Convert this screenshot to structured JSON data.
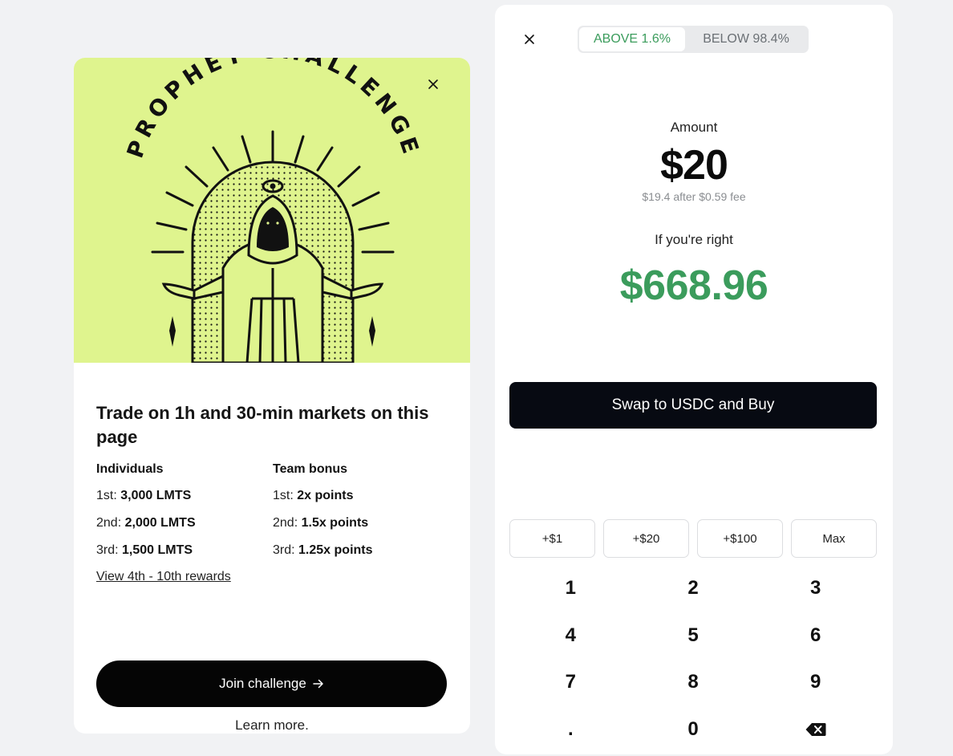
{
  "promo": {
    "hero_text": "PROPHET CHALLENGE",
    "title": "Trade on 1h and 30-min markets on this page",
    "individuals": {
      "heading": "Individuals",
      "rows": [
        {
          "place": "1st:",
          "prize": "3,000 LMTS"
        },
        {
          "place": "2nd:",
          "prize": "2,000 LMTS"
        },
        {
          "place": "3rd:",
          "prize": "1,500 LMTS"
        }
      ]
    },
    "team": {
      "heading": "Team bonus",
      "rows": [
        {
          "place": "1st:",
          "prize": "2x points"
        },
        {
          "place": "2nd:",
          "prize": "1.5x points"
        },
        {
          "place": "3rd:",
          "prize": "1.25x points"
        }
      ]
    },
    "rewards_link": "View 4th - 10th rewards",
    "join_label": "Join challenge",
    "learn_more": "Learn more.",
    "colors": {
      "hero_bg": "#dff48e",
      "button_bg": "#050505"
    }
  },
  "trade": {
    "toggle": {
      "above": "ABOVE 1.6%",
      "below": "BELOW 98.4%",
      "selected": "above"
    },
    "amount_label": "Amount",
    "amount_value": "$20",
    "fee_note": "$19.4 after $0.59 fee",
    "right_label": "If you're right",
    "payout": "$668.96",
    "buy_label": "Swap to USDC and Buy",
    "quick_amounts": [
      "+$1",
      "+$20",
      "+$100",
      "Max"
    ],
    "keypad": [
      "1",
      "2",
      "3",
      "4",
      "5",
      "6",
      "7",
      "8",
      "9",
      ".",
      "0",
      "backspace-icon"
    ],
    "colors": {
      "accent_green": "#3b9c5c",
      "buy_bg": "#070a12"
    }
  }
}
